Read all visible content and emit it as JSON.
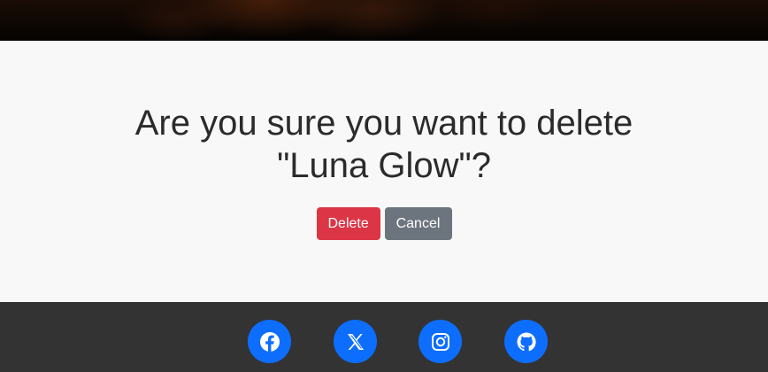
{
  "hero": {
    "image": "dark-brown-hero-image"
  },
  "confirm": {
    "line1": "Are you sure you want to delete",
    "line2": "\"Luna Glow\"?",
    "delete_label": "Delete",
    "cancel_label": "Cancel"
  },
  "footer": {
    "social": [
      {
        "name": "facebook",
        "icon": "facebook-icon"
      },
      {
        "name": "x",
        "icon": "x-icon"
      },
      {
        "name": "instagram",
        "icon": "instagram-icon"
      },
      {
        "name": "github",
        "icon": "github-icon"
      }
    ]
  },
  "colors": {
    "delete": "#dc3545",
    "cancel": "#6c757d",
    "social": "#0d6efd",
    "footer_bg": "#333333"
  }
}
